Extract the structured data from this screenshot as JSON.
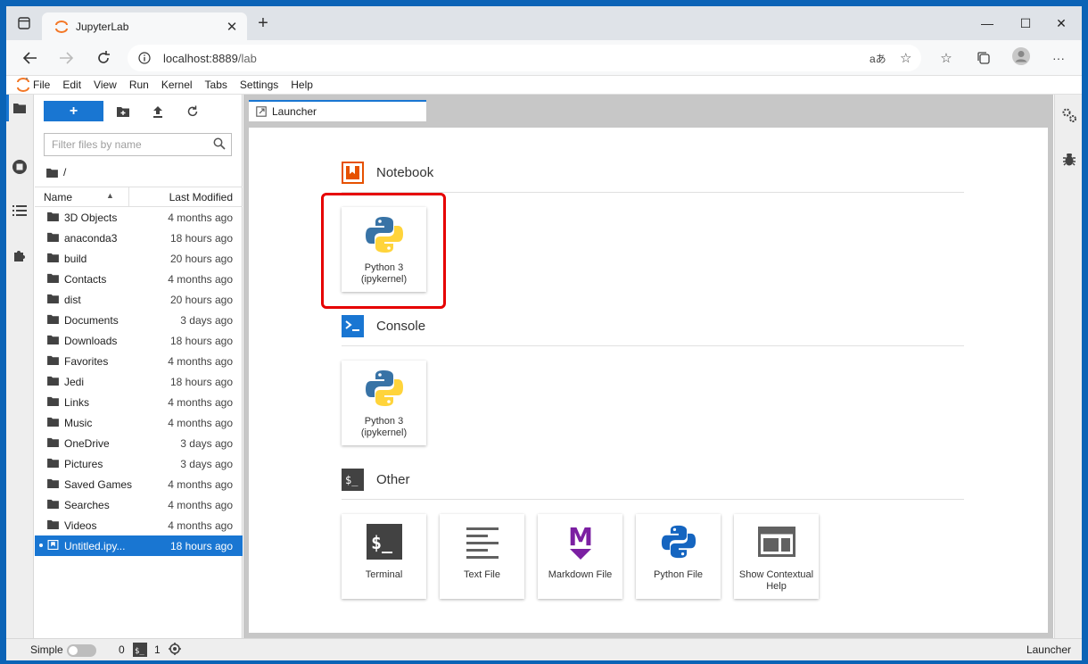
{
  "browser": {
    "tab_title": "JupyterLab",
    "new_tab": "+",
    "close_tab": "✕",
    "url_host": "localhost:8889",
    "url_path": "/lab",
    "minimize": "—",
    "maximize": "☐",
    "close": "✕"
  },
  "menu": [
    "File",
    "Edit",
    "View",
    "Run",
    "Kernel",
    "Tabs",
    "Settings",
    "Help"
  ],
  "filebrowser": {
    "new_label": "+",
    "filter_placeholder": "Filter files by name",
    "breadcrumb": "/",
    "col_name": "Name",
    "col_modified": "Last Modified",
    "rows": [
      {
        "name": "3D Objects",
        "modified": "4 months ago"
      },
      {
        "name": "anaconda3",
        "modified": "18 hours ago"
      },
      {
        "name": "build",
        "modified": "20 hours ago"
      },
      {
        "name": "Contacts",
        "modified": "4 months ago"
      },
      {
        "name": "dist",
        "modified": "20 hours ago"
      },
      {
        "name": "Documents",
        "modified": "3 days ago"
      },
      {
        "name": "Downloads",
        "modified": "18 hours ago"
      },
      {
        "name": "Favorites",
        "modified": "4 months ago"
      },
      {
        "name": "Jedi",
        "modified": "18 hours ago"
      },
      {
        "name": "Links",
        "modified": "4 months ago"
      },
      {
        "name": "Music",
        "modified": "4 months ago"
      },
      {
        "name": "OneDrive",
        "modified": "3 days ago"
      },
      {
        "name": "Pictures",
        "modified": "3 days ago"
      },
      {
        "name": "Saved Games",
        "modified": "4 months ago"
      },
      {
        "name": "Searches",
        "modified": "4 months ago"
      },
      {
        "name": "Videos",
        "modified": "4 months ago"
      },
      {
        "name": "Untitled.ipy...",
        "modified": "18 hours ago"
      }
    ]
  },
  "launcher": {
    "tab_label": "Launcher",
    "notebook_section": "Notebook",
    "console_section": "Console",
    "other_section": "Other",
    "python3": "Python 3",
    "ipykernel": "(ipykernel)",
    "other_items": [
      "Terminal",
      "Text File",
      "Markdown File",
      "Python File"
    ],
    "contextual_help_1": "Show Contextual",
    "contextual_help_2": "Help"
  },
  "statusbar": {
    "mode": "Simple",
    "kernels": "0",
    "terminals": "1",
    "right": "Launcher"
  },
  "colors": {
    "accent": "#1976d2",
    "highlight": "#e60000",
    "notebook_icon": "#e65100",
    "markdown_icon": "#7b1fa2"
  }
}
